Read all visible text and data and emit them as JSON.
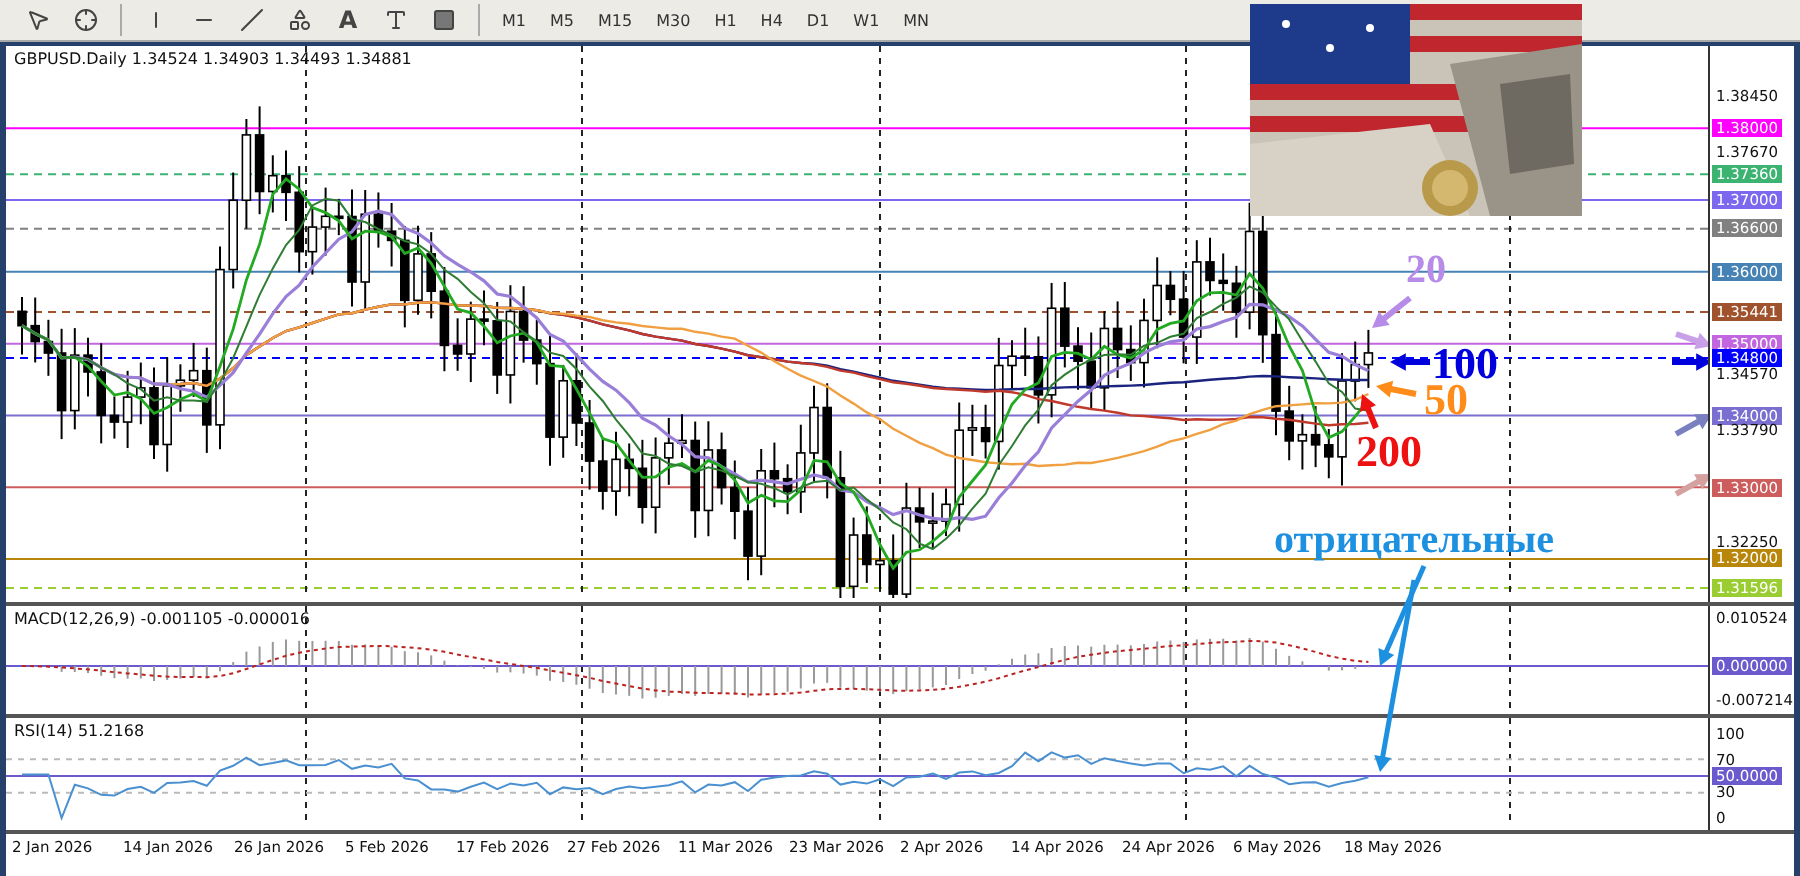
{
  "toolbar": {
    "text_tool": "A",
    "timeframes": [
      {
        "label": "M1"
      },
      {
        "label": "M5"
      },
      {
        "label": "M15"
      },
      {
        "label": "M30"
      },
      {
        "label": "H1"
      },
      {
        "label": "H4"
      },
      {
        "label": "D1"
      },
      {
        "label": "W1"
      },
      {
        "label": "MN"
      }
    ]
  },
  "chart": {
    "title": "GBPUSD.Daily 1.34524 1.34903 1.34493 1.34881",
    "price_labels": [
      {
        "text": "1.38450"
      },
      {
        "text": "1.38000",
        "color": "#ff00ff",
        "kind": "solid"
      },
      {
        "text": "1.37670"
      },
      {
        "text": "1.37360",
        "color": "#3cb371",
        "kind": "dashed"
      },
      {
        "text": "1.37000",
        "color": "#7b68ee",
        "kind": "solid"
      },
      {
        "text": "1.36600",
        "color": "#808080",
        "kind": "dashed"
      },
      {
        "text": "1.36000",
        "color": "#4682b4",
        "kind": "solid"
      },
      {
        "text": "1.35441",
        "color": "#a0522d",
        "kind": "dashed"
      },
      {
        "text": "1.35000",
        "color": "#c266e0",
        "kind": "solid"
      },
      {
        "text": "1.34800",
        "color": "#0000ff",
        "kind": "dashed"
      },
      {
        "text": "1.34570"
      },
      {
        "text": "1.34000",
        "color": "#7a6fd0",
        "kind": "solid"
      },
      {
        "text": "1.33790"
      },
      {
        "text": "1.33000",
        "color": "#cd5c5c",
        "kind": "solid"
      },
      {
        "text": "1.32250"
      },
      {
        "text": "1.32000",
        "color": "#b8860b",
        "kind": "solid"
      },
      {
        "text": "1.31596",
        "color": "#9acd32",
        "kind": "dashed"
      }
    ],
    "annotations": [
      {
        "text": "20",
        "color": "#b78ce8"
      },
      {
        "text": "100",
        "color": "#0000dd"
      },
      {
        "text": "50",
        "color": "#ff8c1a"
      },
      {
        "text": "200",
        "color": "#ee1111"
      },
      {
        "text": "отрицательные",
        "color": "#1e90e0"
      }
    ]
  },
  "macd": {
    "title": "MACD(12,26,9) -0.001105 -0.000016",
    "labels": [
      {
        "text": "0.010524"
      },
      {
        "text": "0.000000",
        "color": "#6a5acd"
      },
      {
        "text": "-0.007214"
      }
    ]
  },
  "rsi": {
    "title": "RSI(14) 51.2168",
    "labels": [
      {
        "text": "100"
      },
      {
        "text": "70"
      },
      {
        "text": "50.0000",
        "color": "#6a5acd"
      },
      {
        "text": "30"
      },
      {
        "text": "0"
      }
    ]
  },
  "dates": [
    "2 Jan 2026",
    "14 Jan 2026",
    "26 Jan 2026",
    "5 Feb 2026",
    "17 Feb 2026",
    "27 Feb 2026",
    "11 Mar 2026",
    "23 Mar 2026",
    "2 Apr 2026",
    "14 Apr 2026",
    "24 Apr 2026",
    "6 May 2026",
    "18 May 2026"
  ]
}
